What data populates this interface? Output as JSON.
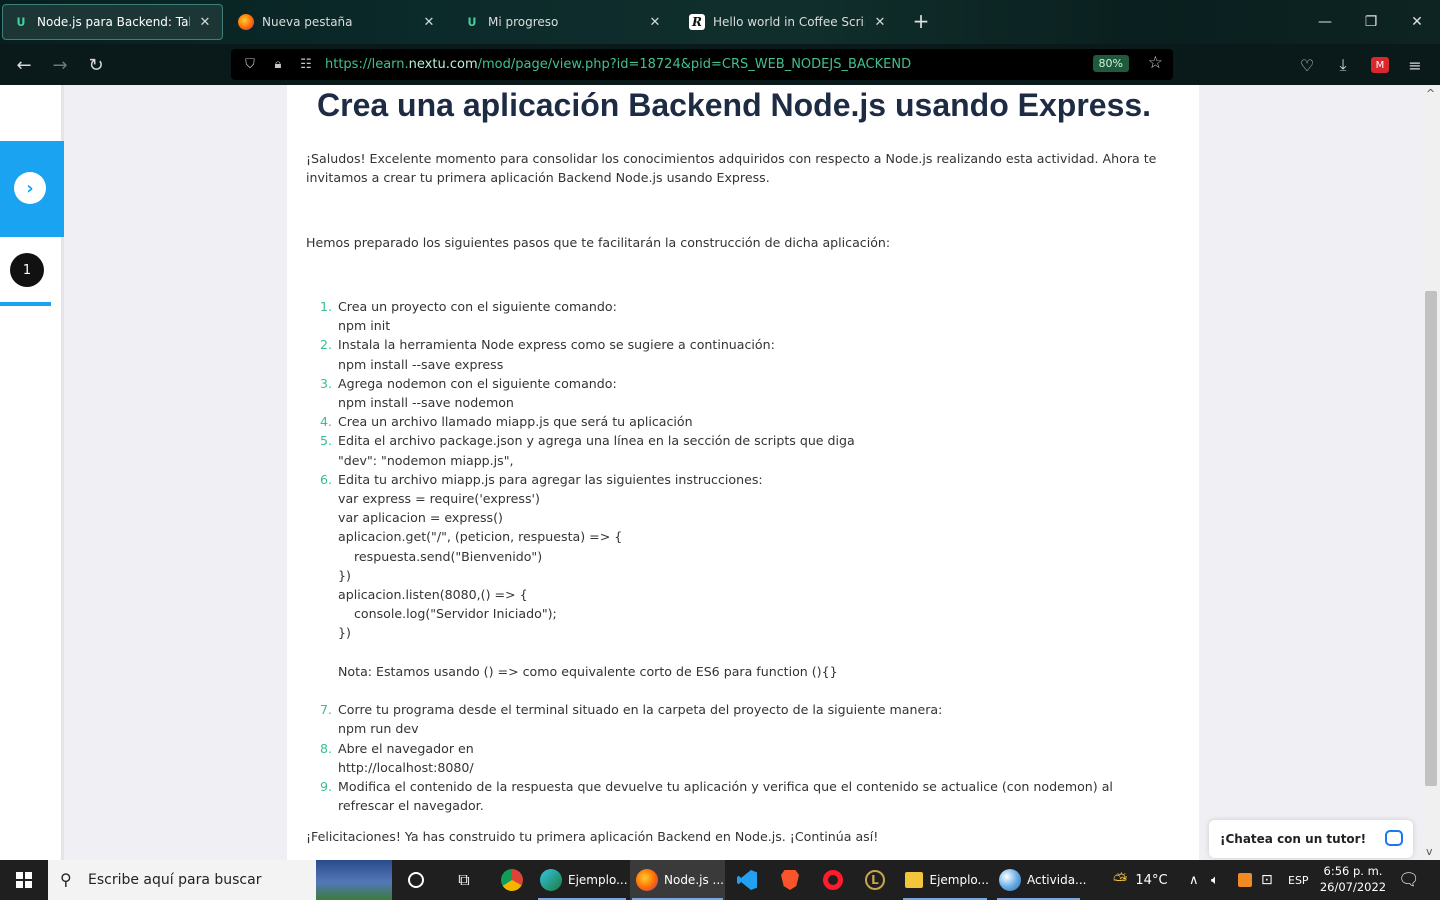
{
  "browser": {
    "tabs": [
      {
        "title": "Node.js para Backend: Taller",
        "active": true,
        "favicon": "nextu-icon"
      },
      {
        "title": "Nueva pestaña",
        "active": false,
        "favicon": "firefox-icon"
      },
      {
        "title": "Mi progreso",
        "active": false,
        "favicon": "nextu-icon"
      },
      {
        "title": "Hello world in Coffee Script | Re",
        "active": false,
        "favicon": "replit-icon"
      }
    ],
    "url_prefix": "https://learn.",
    "url_host": "nextu.com",
    "url_path": "/mod/page/view.php?id=18724&pid=CRS_WEB_NODEJS_BACKEND",
    "zoom": "80%"
  },
  "page": {
    "title": "Crea una aplicación Backend Node.js usando Express.",
    "step_number": "1",
    "intro": "¡Saludos! Excelente momento para consolidar los conocimientos adquiridos con respecto a Node.js realizando esta actividad. Ahora te invitamos a crear tu primera aplicación Backend Node.js usando Express.",
    "prepared": "Hemos preparado los siguientes pasos que te facilitarán la construcción de dicha aplicación:",
    "steps": [
      {
        "num": "1.",
        "lines": [
          "Crea un proyecto con el siguiente comando:",
          "npm init"
        ]
      },
      {
        "num": "2.",
        "lines": [
          "Instala la herramienta Node express como se sugiere a continuación:",
          "npm install --save express"
        ]
      },
      {
        "num": "3.",
        "lines": [
          "Agrega nodemon con el siguiente comando:",
          "npm install --save nodemon"
        ]
      },
      {
        "num": "4.",
        "lines": [
          "Crea un archivo llamado miapp.js que será tu aplicación"
        ]
      },
      {
        "num": "5.",
        "lines": [
          "Edita el archivo package.json y agrega una línea en la sección de scripts que diga",
          "\"dev\": \"nodemon miapp.js\","
        ]
      },
      {
        "num": "6.",
        "lines": [
          "Edita tu archivo miapp.js para agregar las siguientes instrucciones:",
          "var express = require('express')",
          "var aplicacion = express()",
          "aplicacion.get(\"/\", (peticion, respuesta) => {",
          "    respuesta.send(\"Bienvenido\")",
          "})",
          "aplicacion.listen(8080,() => {",
          "    console.log(\"Servidor Iniciado\");",
          "})",
          "",
          "Nota: Estamos usando () => como equivalente corto de ES6 para function (){}",
          ""
        ]
      },
      {
        "num": "7.",
        "lines": [
          "Corre tu programa desde el terminal situado en la carpeta del proyecto de la siguiente manera:",
          "npm run dev"
        ]
      },
      {
        "num": "8.",
        "lines": [
          "Abre el navegador en",
          "http://localhost:8080/"
        ]
      },
      {
        "num": "9.",
        "lines": [
          "Modifica el contenido de la respuesta que devuelve tu aplicación y verifica que el contenido se actualice (con nodemon) al refrescar el navegador."
        ]
      }
    ],
    "closing": "¡Felicitaciones! Ya has construido tu primera aplicación Backend en Node.js. ¡Continúa así!",
    "chat_label": "¡Chatea con un tutor!"
  },
  "taskbar": {
    "search_placeholder": "Escribe aquí para buscar",
    "apps": [
      {
        "label": "Ejemplo...",
        "icon": "edge-icon"
      },
      {
        "label": "Node.js ...",
        "icon": "firefox-icon"
      },
      {
        "label": "Ejemplo...",
        "icon": "file-explorer-icon"
      },
      {
        "label": "Activida...",
        "icon": "paint-icon"
      }
    ],
    "weather": "14°C",
    "language": "ESP",
    "time": "6:56 p. m.",
    "date": "26/07/2022"
  },
  "colors": {
    "accent_blue": "#1aa3f0",
    "step_number_green": "#35c28a",
    "title_navy": "#1e2b44"
  }
}
